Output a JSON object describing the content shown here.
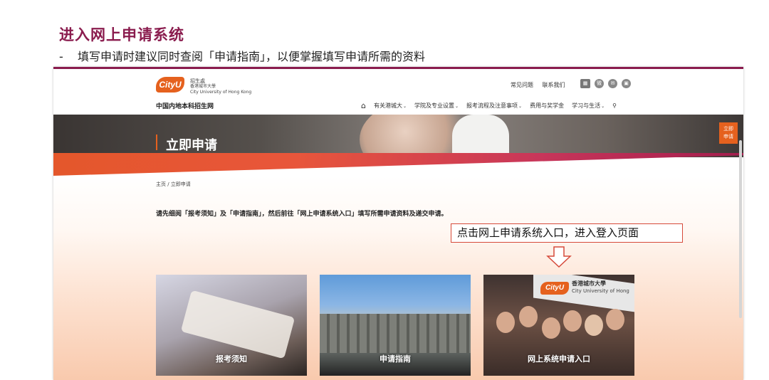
{
  "slide": {
    "title": "进入网上申请系统",
    "bullet_dash": "-",
    "bullet": "填写申请时建议同时查阅「申请指南」，以便掌握填写申请所需的资料"
  },
  "header": {
    "logo": "CityU",
    "logo_cn": "招生處",
    "logo_sub1": "香港城市大學",
    "logo_sub2": "City University of Hong Kong",
    "site_name": "中国内地本科招生网",
    "top_links": [
      "常见问题",
      "联系我们"
    ],
    "social_icons": [
      "wechat-qr-icon",
      "weibo-icon",
      "wechat-icon",
      "bilibili-icon"
    ]
  },
  "nav": {
    "items": [
      {
        "label": "有关港城大",
        "has_dropdown": true
      },
      {
        "label": "学院及专业设置",
        "has_dropdown": true
      },
      {
        "label": "报考流程及注意事项",
        "has_dropdown": true
      },
      {
        "label": "费用与奖学金",
        "has_dropdown": false
      },
      {
        "label": "学习与生活",
        "has_dropdown": true
      }
    ],
    "chevron": "⌄"
  },
  "banner": {
    "title": "立即申请",
    "apply_tab": [
      "立即",
      "申请"
    ]
  },
  "breadcrumb": "主页 / 立即申请",
  "intro": "请先细阅「报考须知」及「申请指南」，然后前往「网上申请系统入口」填写所需申请资料及递交申请。",
  "callout": "点击网上申请系统入口，进入登入页面",
  "cards": [
    {
      "label": "报考须知"
    },
    {
      "label": "申请指南"
    },
    {
      "label": "网上系统申请入口"
    }
  ],
  "card3_sign": {
    "logo": "CityU",
    "cn": "香港城市大學",
    "en": "City University of Hong"
  },
  "colors": {
    "accent": "#e5611e",
    "title": "#8a1c4e",
    "callout_border": "#d64a3a"
  }
}
